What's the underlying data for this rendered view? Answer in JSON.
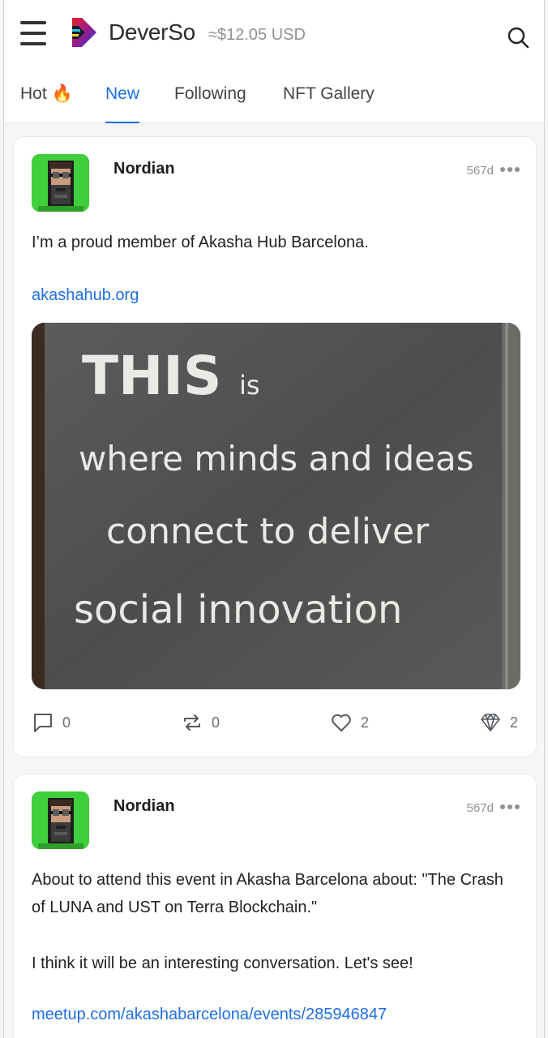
{
  "header": {
    "brand": "DeverSo",
    "balance": "≈$12.05 USD"
  },
  "tabs": [
    {
      "label": "Hot 🔥",
      "active": false
    },
    {
      "label": "New",
      "active": true
    },
    {
      "label": "Following",
      "active": false
    },
    {
      "label": "NFT Gallery",
      "active": false
    }
  ],
  "posts": [
    {
      "author": "Nordian",
      "time": "567d",
      "text": "I’m a proud member of Akasha Hub Barcelona.",
      "link": "akashahub.org",
      "image_text": [
        "THIS",
        "is",
        "where minds and ideas",
        "connect to deliver",
        "social innovation"
      ],
      "comments": "0",
      "reposts": "0",
      "likes": "2",
      "gems": "2"
    },
    {
      "author": "Nordian",
      "time": "567d",
      "text": "About to attend this event in Akasha Barcelona about: \"The Crash of LUNA and UST on Terra Blockchain.\"",
      "text2": "I think it will be an interesting conversation. Let's see!",
      "link": "meetup.com/akashabarcelona/events/285946847"
    }
  ],
  "icons": {
    "menu": "hamburger-icon",
    "search": "search-icon",
    "more": "more-dots-icon",
    "comment": "comment-icon",
    "repost": "repost-icon",
    "like": "heart-icon",
    "gem": "diamond-icon"
  },
  "colors": {
    "accent": "#1f6fe0",
    "avatar_bg": "#3fcf3c",
    "muted": "#8d9196"
  }
}
